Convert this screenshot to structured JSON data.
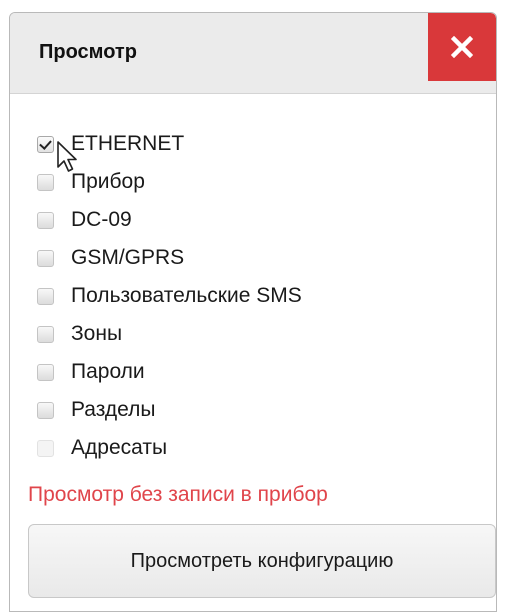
{
  "dialog": {
    "title": "Просмотр",
    "close_icon": "close-icon",
    "colors": {
      "close_bg": "#d9383a",
      "note_text": "#e0454b",
      "titlebar_bg": "#ebebeb"
    }
  },
  "options": [
    {
      "label": "ETHERNET",
      "checked": true,
      "disabled": false
    },
    {
      "label": "Прибор",
      "checked": false,
      "disabled": false
    },
    {
      "label": "DC-09",
      "checked": false,
      "disabled": false
    },
    {
      "label": "GSM/GPRS",
      "checked": false,
      "disabled": false
    },
    {
      "label": "Пользовательские SMS",
      "checked": false,
      "disabled": false
    },
    {
      "label": "Зоны",
      "checked": false,
      "disabled": false
    },
    {
      "label": "Пароли",
      "checked": false,
      "disabled": false
    },
    {
      "label": "Разделы",
      "checked": false,
      "disabled": false
    },
    {
      "label": "Адресаты",
      "checked": false,
      "disabled": true
    }
  ],
  "note": "Просмотр без записи в прибор",
  "view_button_label": "Просмотреть конфигурацию"
}
